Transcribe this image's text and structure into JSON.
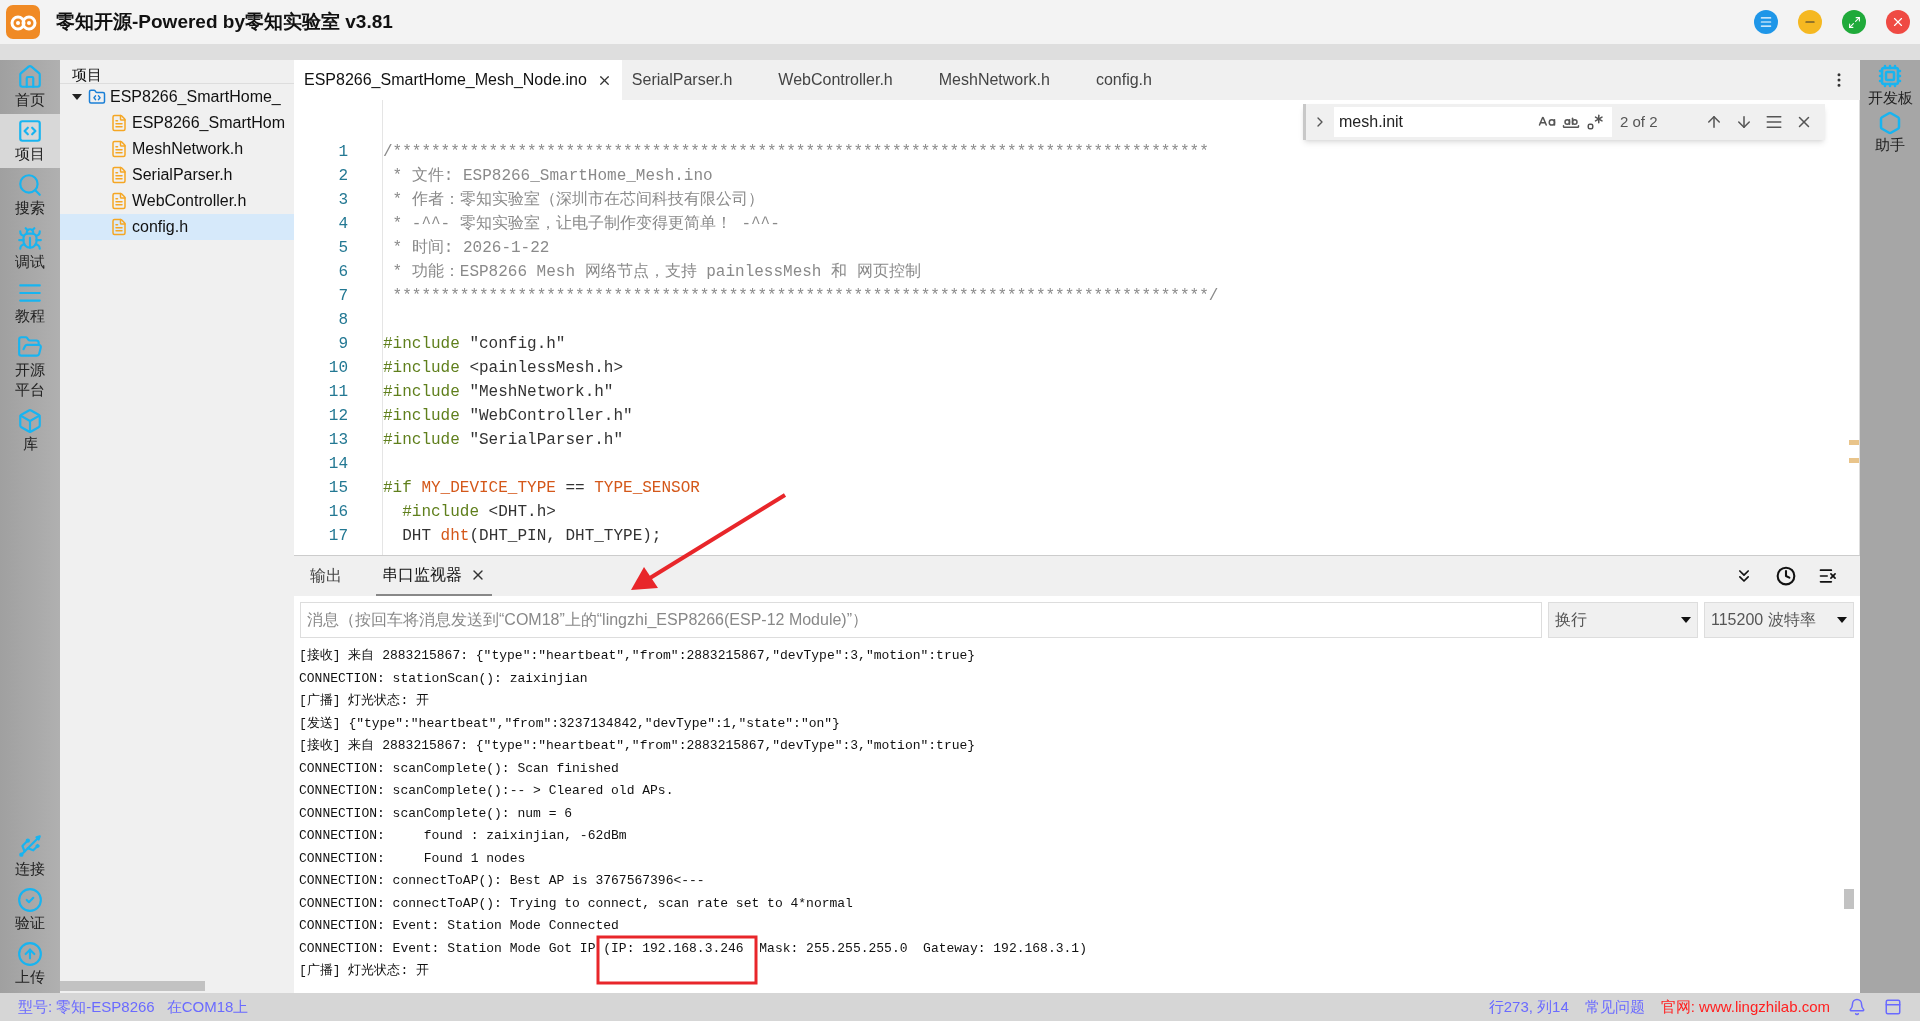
{
  "window": {
    "title": "零知开源-Powered by零知实验室 v3.81"
  },
  "activity_bar": [
    {
      "label": "首页",
      "selected": false
    },
    {
      "label": "项目",
      "selected": true
    },
    {
      "label": "搜索",
      "selected": false
    },
    {
      "label": "调试",
      "selected": false
    },
    {
      "label": "教程",
      "selected": false
    },
    {
      "label": "开源平台",
      "selected": false
    },
    {
      "label": "库",
      "selected": false
    }
  ],
  "activity_bar_bottom": [
    {
      "label": "连接"
    },
    {
      "label": "验证"
    },
    {
      "label": "上传"
    }
  ],
  "right_bar": [
    {
      "label": "开发板"
    },
    {
      "label": "助手"
    }
  ],
  "project_panel": {
    "title": "项目",
    "tree": [
      {
        "label": "ESP8266_SmartHome_",
        "kind": "folder",
        "expanded": true,
        "selected": false,
        "children": [
          {
            "label": "ESP8266_SmartHom",
            "kind": "file",
            "selected": false
          },
          {
            "label": "MeshNetwork.h",
            "kind": "file",
            "selected": false
          },
          {
            "label": "SerialParser.h",
            "kind": "file",
            "selected": false
          },
          {
            "label": "WebController.h",
            "kind": "file",
            "selected": false
          },
          {
            "label": "config.h",
            "kind": "file",
            "selected": true
          }
        ]
      }
    ]
  },
  "editor_tabs": [
    {
      "label": "ESP8266_SmartHome_Mesh_Node.ino",
      "selected": true
    },
    {
      "label": "SerialParser.h",
      "selected": false
    },
    {
      "label": "WebController.h",
      "selected": false
    },
    {
      "label": "MeshNetwork.h",
      "selected": false
    },
    {
      "label": "config.h",
      "selected": false
    }
  ],
  "find_widget": {
    "value": "mesh.init",
    "result": "2 of 2"
  },
  "code": [
    {
      "number": "1",
      "tokens": [
        {
          "kind": "comment",
          "text": "/*************************************************************************************"
        }
      ]
    },
    {
      "number": "2",
      "tokens": [
        {
          "kind": "comment",
          "text": " * 文件: ESP8266_SmartHome_Mesh.ino"
        }
      ]
    },
    {
      "number": "3",
      "tokens": [
        {
          "kind": "comment",
          "text": " * 作者：零知实验室（深圳市在芯间科技有限公司）"
        }
      ]
    },
    {
      "number": "4",
      "tokens": [
        {
          "kind": "comment",
          "text": " * -^^- 零知实验室，让电子制作变得更简单！ -^^-"
        }
      ]
    },
    {
      "number": "5",
      "tokens": [
        {
          "kind": "comment",
          "text": " * 时间: 2026-1-22"
        }
      ]
    },
    {
      "number": "6",
      "tokens": [
        {
          "kind": "comment",
          "text": " * 功能：ESP8266 Mesh 网络节点，支持 painlessMesh 和 网页控制"
        }
      ]
    },
    {
      "number": "7",
      "tokens": [
        {
          "kind": "comment",
          "text": " *************************************************************************************/"
        }
      ]
    },
    {
      "number": "8"
    },
    {
      "number": "9",
      "tokens": [
        {
          "kind": "directive",
          "text": "#include"
        },
        {
          "kind": "plain",
          "text": " \"config.h\""
        }
      ]
    },
    {
      "number": "10",
      "tokens": [
        {
          "kind": "directive",
          "text": "#include"
        },
        {
          "kind": "plain",
          "text": " <painlessMesh.h>"
        }
      ]
    },
    {
      "number": "11",
      "tokens": [
        {
          "kind": "directive",
          "text": "#include"
        },
        {
          "kind": "plain",
          "text": " \"MeshNetwork.h\""
        }
      ]
    },
    {
      "number": "12",
      "tokens": [
        {
          "kind": "directive",
          "text": "#include"
        },
        {
          "kind": "plain",
          "text": " \"WebController.h\""
        }
      ]
    },
    {
      "number": "13",
      "tokens": [
        {
          "kind": "directive",
          "text": "#include"
        },
        {
          "kind": "plain",
          "text": " \"SerialParser.h\""
        }
      ]
    },
    {
      "number": "14"
    },
    {
      "number": "15",
      "tokens": [
        {
          "kind": "directive",
          "text": "#if "
        },
        {
          "kind": "macro",
          "text": "MY_DEVICE_TYPE"
        },
        {
          "kind": "plain",
          "text": " == "
        },
        {
          "kind": "macro",
          "text": "TYPE_SENSOR"
        }
      ]
    },
    {
      "number": "16",
      "tokens": [
        {
          "kind": "directive",
          "text": "  #include"
        },
        {
          "kind": "plain",
          "text": " <DHT.h>"
        }
      ]
    },
    {
      "number": "17",
      "tokens": [
        {
          "kind": "plain",
          "text": "  DHT "
        },
        {
          "kind": "macro",
          "text": "dht"
        },
        {
          "kind": "plain",
          "text": "(DHT_PIN, DHT_TYPE);"
        }
      ]
    }
  ],
  "bottom_panel": {
    "tabs": [
      {
        "label": "输出",
        "selected": false
      },
      {
        "label": "串口监视器",
        "selected": true
      }
    ],
    "message_field": {
      "placeholder": "消息（按回车将消息发送到“COM18”上的“lingzhi_ESP8266(ESP-12 Module)”）"
    },
    "line_ending": "换行",
    "baud_rate": "115200 波特率",
    "output": [
      "[接收] 来自 2883215867: {\"type\":\"heartbeat\",\"from\":2883215867,\"devType\":3,\"motion\":true}",
      "CONNECTION: stationScan(): zaixinjian",
      "[广播] 灯光状态: 开",
      "[发送] {\"type\":\"heartbeat\",\"from\":3237134842,\"devType\":1,\"state\":\"on\"}",
      "[接收] 来自 2883215867: {\"type\":\"heartbeat\",\"from\":2883215867,\"devType\":3,\"motion\":true}",
      "CONNECTION: scanComplete(): Scan finished",
      "CONNECTION: scanComplete():-- > Cleared old APs.",
      "CONNECTION: scanComplete(): num = 6",
      "CONNECTION:     found : zaixinjian, -62dBm",
      "CONNECTION:     Found 1 nodes",
      "CONNECTION: connectToAP(): Best AP is 3767567396<---",
      "CONNECTION: connectToAP(): Trying to connect, scan rate set to 4*normal",
      "CONNECTION: Event: Station Mode Connected",
      "CONNECTION: Event: Station Mode Got IP (IP: 192.168.3.246  Mask: 255.255.255.0  Gateway: 192.168.3.1)",
      "[广播] 灯光状态: 开"
    ]
  },
  "status_bar": {
    "board": "型号: 零知-ESP8266",
    "port": "在COM18上",
    "position": "行273, 列14",
    "faq": "常见问题",
    "website": "官网: www.lingzhilab.com"
  }
}
